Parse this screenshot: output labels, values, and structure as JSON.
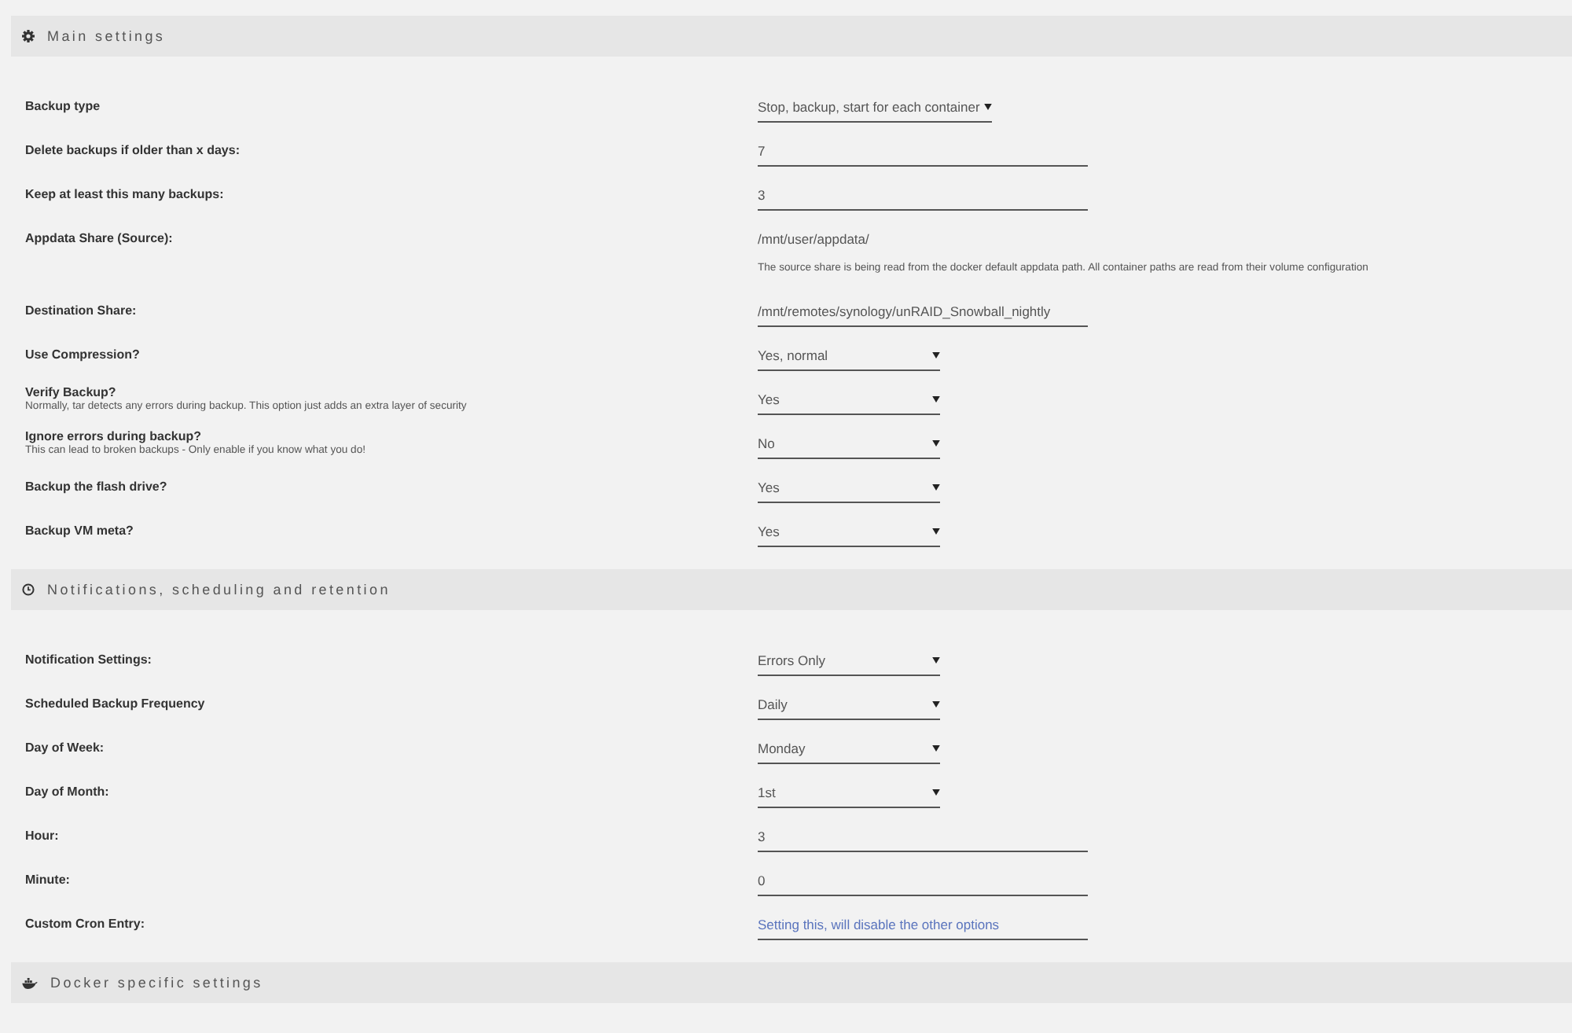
{
  "sections": [
    {
      "title": "Main settings",
      "rows": [
        {
          "kind": "select",
          "label": "Backup type",
          "value": "Stop, backup, start for each container"
        },
        {
          "kind": "text",
          "label": "Delete backups if older than x days:",
          "value": "7"
        },
        {
          "kind": "text",
          "label": "Keep at least this many backups:",
          "value": "3"
        },
        {
          "kind": "static",
          "label": "Appdata Share (Source):",
          "value": "/mnt/user/appdata/",
          "note": "The source share is being read from the docker default appdata path. All container paths are read from their volume configuration"
        },
        {
          "kind": "text",
          "label": "Destination Share:",
          "value": "/mnt/remotes/synology/unRAID_Snowball_nightly"
        },
        {
          "kind": "select",
          "label": "Use Compression?",
          "value": "Yes, normal"
        },
        {
          "kind": "select",
          "label": "Verify Backup?",
          "hint": "Normally, tar detects any errors during backup. This option just adds an extra layer of security",
          "value": "Yes"
        },
        {
          "kind": "select",
          "label": "Ignore errors during backup?",
          "hint": "This can lead to broken backups - Only enable if you know what you do!",
          "value": "No"
        },
        {
          "kind": "select",
          "label": "Backup the flash drive?",
          "value": "Yes"
        },
        {
          "kind": "select",
          "label": "Backup VM meta?",
          "value": "Yes"
        }
      ]
    },
    {
      "title": "Notifications, scheduling and retention",
      "rows": [
        {
          "kind": "select",
          "label": "Notification Settings:",
          "value": "Errors Only"
        },
        {
          "kind": "select",
          "label": "Scheduled Backup Frequency",
          "value": "Daily"
        },
        {
          "kind": "select",
          "label": "Day of Week:",
          "value": "Monday"
        },
        {
          "kind": "select",
          "label": "Day of Month:",
          "value": "1st"
        },
        {
          "kind": "text",
          "label": "Hour:",
          "value": "3"
        },
        {
          "kind": "text",
          "label": "Minute:",
          "value": "0"
        },
        {
          "kind": "text",
          "label": "Custom Cron Entry:",
          "placeholder": "Setting this, will disable the other options"
        }
      ]
    },
    {
      "title": "Docker specific settings"
    }
  ]
}
